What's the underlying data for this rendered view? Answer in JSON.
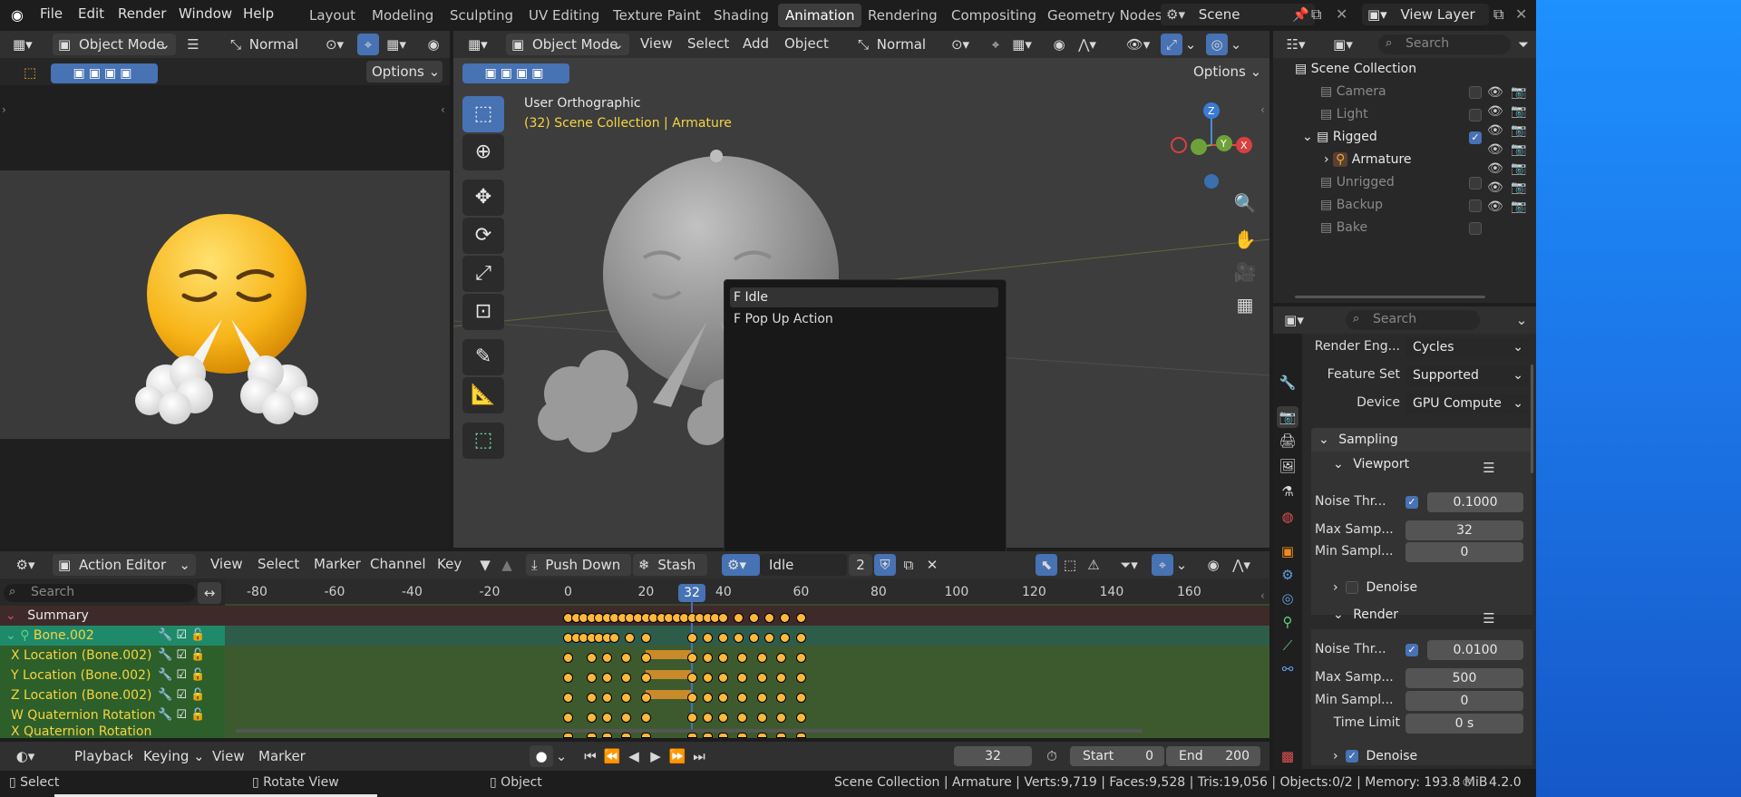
{
  "menu": {
    "items": [
      "File",
      "Edit",
      "Render",
      "Window",
      "Help"
    ]
  },
  "workspaces": [
    "Layout",
    "Modeling",
    "Sculpting",
    "UV Editing",
    "Texture Paint",
    "Shading",
    "Animation",
    "Rendering",
    "Compositing",
    "Geometry Nodes"
  ],
  "active_workspace": "Animation",
  "scene": {
    "name": "Scene",
    "view_layer": "View Layer"
  },
  "left_viewport": {
    "mode": "Object Mode",
    "transform": "Normal",
    "options": "Options"
  },
  "viewport": {
    "mode": "Object Mode",
    "menus": [
      "View",
      "Select",
      "Add",
      "Object"
    ],
    "transform": "Normal",
    "options": "Options",
    "view_name": "User Orthographic",
    "context": "(32) Scene Collection | Armature"
  },
  "action_popup": {
    "items": [
      "F Idle",
      "F Pop Up Action"
    ],
    "highlighted": "F Idle",
    "search_value": ""
  },
  "outliner": {
    "search_placeholder": "Search",
    "root": "Scene Collection",
    "items": [
      "Camera",
      "Light",
      "Rigged",
      "Armature",
      "Unrigged",
      "Backup",
      "Bake"
    ]
  },
  "properties": {
    "search_placeholder": "Search",
    "render_engine_label": "Render Eng...",
    "render_engine": "Cycles",
    "feature_set_label": "Feature Set",
    "feature_set": "Supported",
    "device_label": "Device",
    "device": "GPU Compute",
    "sampling": "Sampling",
    "viewport": "Viewport",
    "vp_noise_label": "Noise Thr...",
    "vp_noise": "0.1000",
    "vp_max_label": "Max Samp...",
    "vp_max": "32",
    "vp_min_label": "Min Sampl...",
    "vp_min": "0",
    "denoise": "Denoise",
    "render": "Render",
    "r_noise_label": "Noise Thr...",
    "r_noise": "0.0100",
    "r_max_label": "Max Samp...",
    "r_max": "500",
    "r_min_label": "Min Sampl...",
    "r_min": "0",
    "time_limit_label": "Time Limit",
    "time_limit": "0 s",
    "denoise2": "Denoise"
  },
  "action_editor": {
    "editor": "Action Editor",
    "menus": [
      "View",
      "Select",
      "Marker",
      "Channel",
      "Key"
    ],
    "push_down": "Push Down",
    "stash": "Stash",
    "action_name": "Idle",
    "users": "2",
    "search_placeholder": "Search",
    "current_frame": "32",
    "ticks": [
      "-80",
      "-60",
      "-40",
      "-20",
      "0",
      "20",
      "40",
      "60",
      "80",
      "100",
      "120",
      "140",
      "160"
    ],
    "channels": [
      "Summary",
      "Bone.002",
      "X Location (Bone.002)",
      "Y Location (Bone.002)",
      "Z Location (Bone.002)",
      "W Quaternion Rotation (B",
      "X Quaternion Rotation (B"
    ]
  },
  "timeline": {
    "menus": [
      "Playback",
      "Keying",
      "View",
      "Marker"
    ],
    "frame": "32",
    "start_label": "Start",
    "start": "0",
    "end_label": "End",
    "end": "200"
  },
  "statusbar": {
    "select": "Select",
    "rotate": "Rotate View",
    "object": "Object",
    "info": "Scene Collection | Armature | Verts:9,719 | Faces:9,528 | Tris:19,056 | Objects:0/2 | Memory: 193.8 MiB",
    "version": "4.2.0"
  },
  "colors": {
    "accent": "#4772b3",
    "keyframe": "#ffb83b",
    "current_frame": "#4772b3",
    "context_text": "#f5d442"
  }
}
